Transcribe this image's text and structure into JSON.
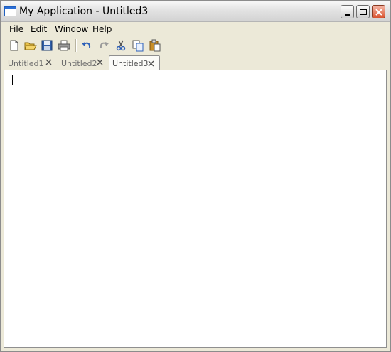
{
  "window": {
    "title": "My Application - Untitled3",
    "controls": [
      "minimize-icon",
      "maximize-icon",
      "close-icon"
    ]
  },
  "menubar": {
    "items": [
      {
        "label": "File"
      },
      {
        "label": "Edit"
      },
      {
        "label": "Window"
      },
      {
        "label": "Help"
      }
    ]
  },
  "toolbar": {
    "buttons": [
      {
        "icon": "new-document-icon"
      },
      {
        "icon": "open-folder-icon"
      },
      {
        "icon": "save-disk-icon"
      },
      {
        "icon": "print-icon"
      },
      {
        "icon": "undo-icon"
      },
      {
        "icon": "redo-icon"
      },
      {
        "icon": "cut-icon"
      },
      {
        "icon": "copy-icon"
      },
      {
        "icon": "paste-icon"
      }
    ]
  },
  "tabs": [
    {
      "label": "Untitled1",
      "active": false
    },
    {
      "label": "Untitled2",
      "active": false
    },
    {
      "label": "Untitled3",
      "active": true
    }
  ],
  "editor": {
    "content": ""
  },
  "colors": {
    "chrome": "#ece9d8",
    "close_button": "#d9532f",
    "accent_blue": "#2c6fd6"
  }
}
